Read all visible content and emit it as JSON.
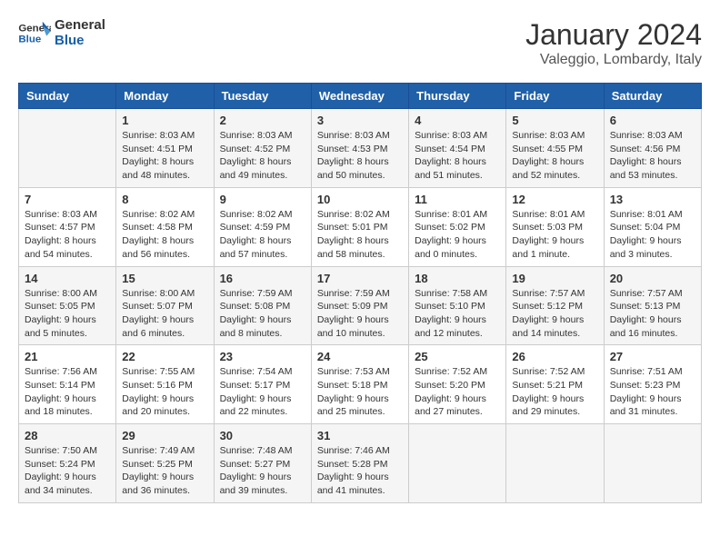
{
  "header": {
    "logo_general": "General",
    "logo_blue": "Blue",
    "month": "January 2024",
    "location": "Valeggio, Lombardy, Italy"
  },
  "weekdays": [
    "Sunday",
    "Monday",
    "Tuesday",
    "Wednesday",
    "Thursday",
    "Friday",
    "Saturday"
  ],
  "weeks": [
    [
      {
        "day": "",
        "info": ""
      },
      {
        "day": "1",
        "info": "Sunrise: 8:03 AM\nSunset: 4:51 PM\nDaylight: 8 hours\nand 48 minutes."
      },
      {
        "day": "2",
        "info": "Sunrise: 8:03 AM\nSunset: 4:52 PM\nDaylight: 8 hours\nand 49 minutes."
      },
      {
        "day": "3",
        "info": "Sunrise: 8:03 AM\nSunset: 4:53 PM\nDaylight: 8 hours\nand 50 minutes."
      },
      {
        "day": "4",
        "info": "Sunrise: 8:03 AM\nSunset: 4:54 PM\nDaylight: 8 hours\nand 51 minutes."
      },
      {
        "day": "5",
        "info": "Sunrise: 8:03 AM\nSunset: 4:55 PM\nDaylight: 8 hours\nand 52 minutes."
      },
      {
        "day": "6",
        "info": "Sunrise: 8:03 AM\nSunset: 4:56 PM\nDaylight: 8 hours\nand 53 minutes."
      }
    ],
    [
      {
        "day": "7",
        "info": "Sunrise: 8:03 AM\nSunset: 4:57 PM\nDaylight: 8 hours\nand 54 minutes."
      },
      {
        "day": "8",
        "info": "Sunrise: 8:02 AM\nSunset: 4:58 PM\nDaylight: 8 hours\nand 56 minutes."
      },
      {
        "day": "9",
        "info": "Sunrise: 8:02 AM\nSunset: 4:59 PM\nDaylight: 8 hours\nand 57 minutes."
      },
      {
        "day": "10",
        "info": "Sunrise: 8:02 AM\nSunset: 5:01 PM\nDaylight: 8 hours\nand 58 minutes."
      },
      {
        "day": "11",
        "info": "Sunrise: 8:01 AM\nSunset: 5:02 PM\nDaylight: 9 hours\nand 0 minutes."
      },
      {
        "day": "12",
        "info": "Sunrise: 8:01 AM\nSunset: 5:03 PM\nDaylight: 9 hours\nand 1 minute."
      },
      {
        "day": "13",
        "info": "Sunrise: 8:01 AM\nSunset: 5:04 PM\nDaylight: 9 hours\nand 3 minutes."
      }
    ],
    [
      {
        "day": "14",
        "info": "Sunrise: 8:00 AM\nSunset: 5:05 PM\nDaylight: 9 hours\nand 5 minutes."
      },
      {
        "day": "15",
        "info": "Sunrise: 8:00 AM\nSunset: 5:07 PM\nDaylight: 9 hours\nand 6 minutes."
      },
      {
        "day": "16",
        "info": "Sunrise: 7:59 AM\nSunset: 5:08 PM\nDaylight: 9 hours\nand 8 minutes."
      },
      {
        "day": "17",
        "info": "Sunrise: 7:59 AM\nSunset: 5:09 PM\nDaylight: 9 hours\nand 10 minutes."
      },
      {
        "day": "18",
        "info": "Sunrise: 7:58 AM\nSunset: 5:10 PM\nDaylight: 9 hours\nand 12 minutes."
      },
      {
        "day": "19",
        "info": "Sunrise: 7:57 AM\nSunset: 5:12 PM\nDaylight: 9 hours\nand 14 minutes."
      },
      {
        "day": "20",
        "info": "Sunrise: 7:57 AM\nSunset: 5:13 PM\nDaylight: 9 hours\nand 16 minutes."
      }
    ],
    [
      {
        "day": "21",
        "info": "Sunrise: 7:56 AM\nSunset: 5:14 PM\nDaylight: 9 hours\nand 18 minutes."
      },
      {
        "day": "22",
        "info": "Sunrise: 7:55 AM\nSunset: 5:16 PM\nDaylight: 9 hours\nand 20 minutes."
      },
      {
        "day": "23",
        "info": "Sunrise: 7:54 AM\nSunset: 5:17 PM\nDaylight: 9 hours\nand 22 minutes."
      },
      {
        "day": "24",
        "info": "Sunrise: 7:53 AM\nSunset: 5:18 PM\nDaylight: 9 hours\nand 25 minutes."
      },
      {
        "day": "25",
        "info": "Sunrise: 7:52 AM\nSunset: 5:20 PM\nDaylight: 9 hours\nand 27 minutes."
      },
      {
        "day": "26",
        "info": "Sunrise: 7:52 AM\nSunset: 5:21 PM\nDaylight: 9 hours\nand 29 minutes."
      },
      {
        "day": "27",
        "info": "Sunrise: 7:51 AM\nSunset: 5:23 PM\nDaylight: 9 hours\nand 31 minutes."
      }
    ],
    [
      {
        "day": "28",
        "info": "Sunrise: 7:50 AM\nSunset: 5:24 PM\nDaylight: 9 hours\nand 34 minutes."
      },
      {
        "day": "29",
        "info": "Sunrise: 7:49 AM\nSunset: 5:25 PM\nDaylight: 9 hours\nand 36 minutes."
      },
      {
        "day": "30",
        "info": "Sunrise: 7:48 AM\nSunset: 5:27 PM\nDaylight: 9 hours\nand 39 minutes."
      },
      {
        "day": "31",
        "info": "Sunrise: 7:46 AM\nSunset: 5:28 PM\nDaylight: 9 hours\nand 41 minutes."
      },
      {
        "day": "",
        "info": ""
      },
      {
        "day": "",
        "info": ""
      },
      {
        "day": "",
        "info": ""
      }
    ]
  ]
}
